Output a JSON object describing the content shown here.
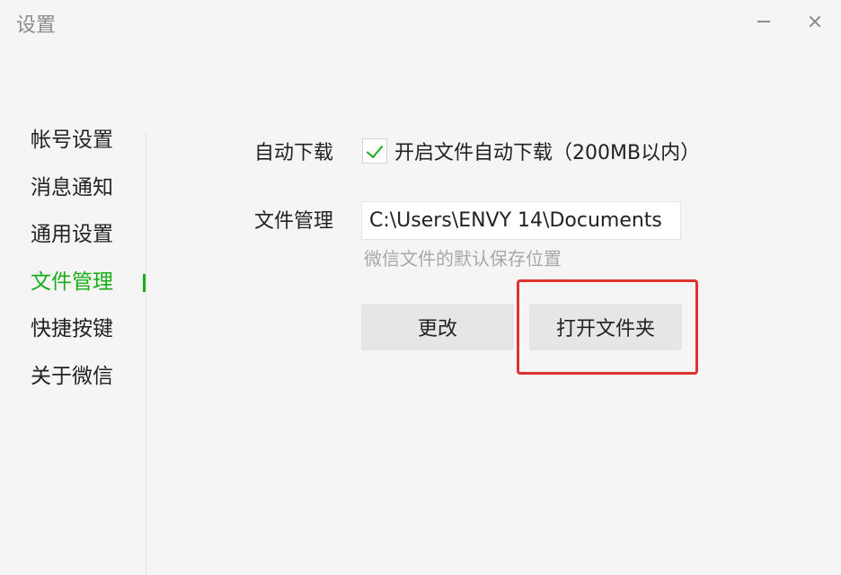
{
  "window": {
    "title": "设置",
    "minimize_icon": "minimize-icon",
    "close_icon": "close-icon"
  },
  "sidebar": {
    "items": [
      {
        "label": "帐号设置"
      },
      {
        "label": "消息通知"
      },
      {
        "label": "通用设置"
      },
      {
        "label": "文件管理"
      },
      {
        "label": "快捷按键"
      },
      {
        "label": "关于微信"
      }
    ],
    "active_index": 3
  },
  "file_management": {
    "auto_download_label": "自动下载",
    "auto_download_checked": true,
    "auto_download_option": "开启文件自动下载（200MB以内）",
    "file_manage_label": "文件管理",
    "save_path": "C:\\Users\\ENVY 14\\Documents",
    "save_path_hint": "微信文件的默认保存位置",
    "change_button": "更改",
    "open_folder_button": "打开文件夹"
  },
  "colors": {
    "accent": "#1aad19",
    "highlight": "#e03030",
    "background": "#f5f5f5"
  }
}
